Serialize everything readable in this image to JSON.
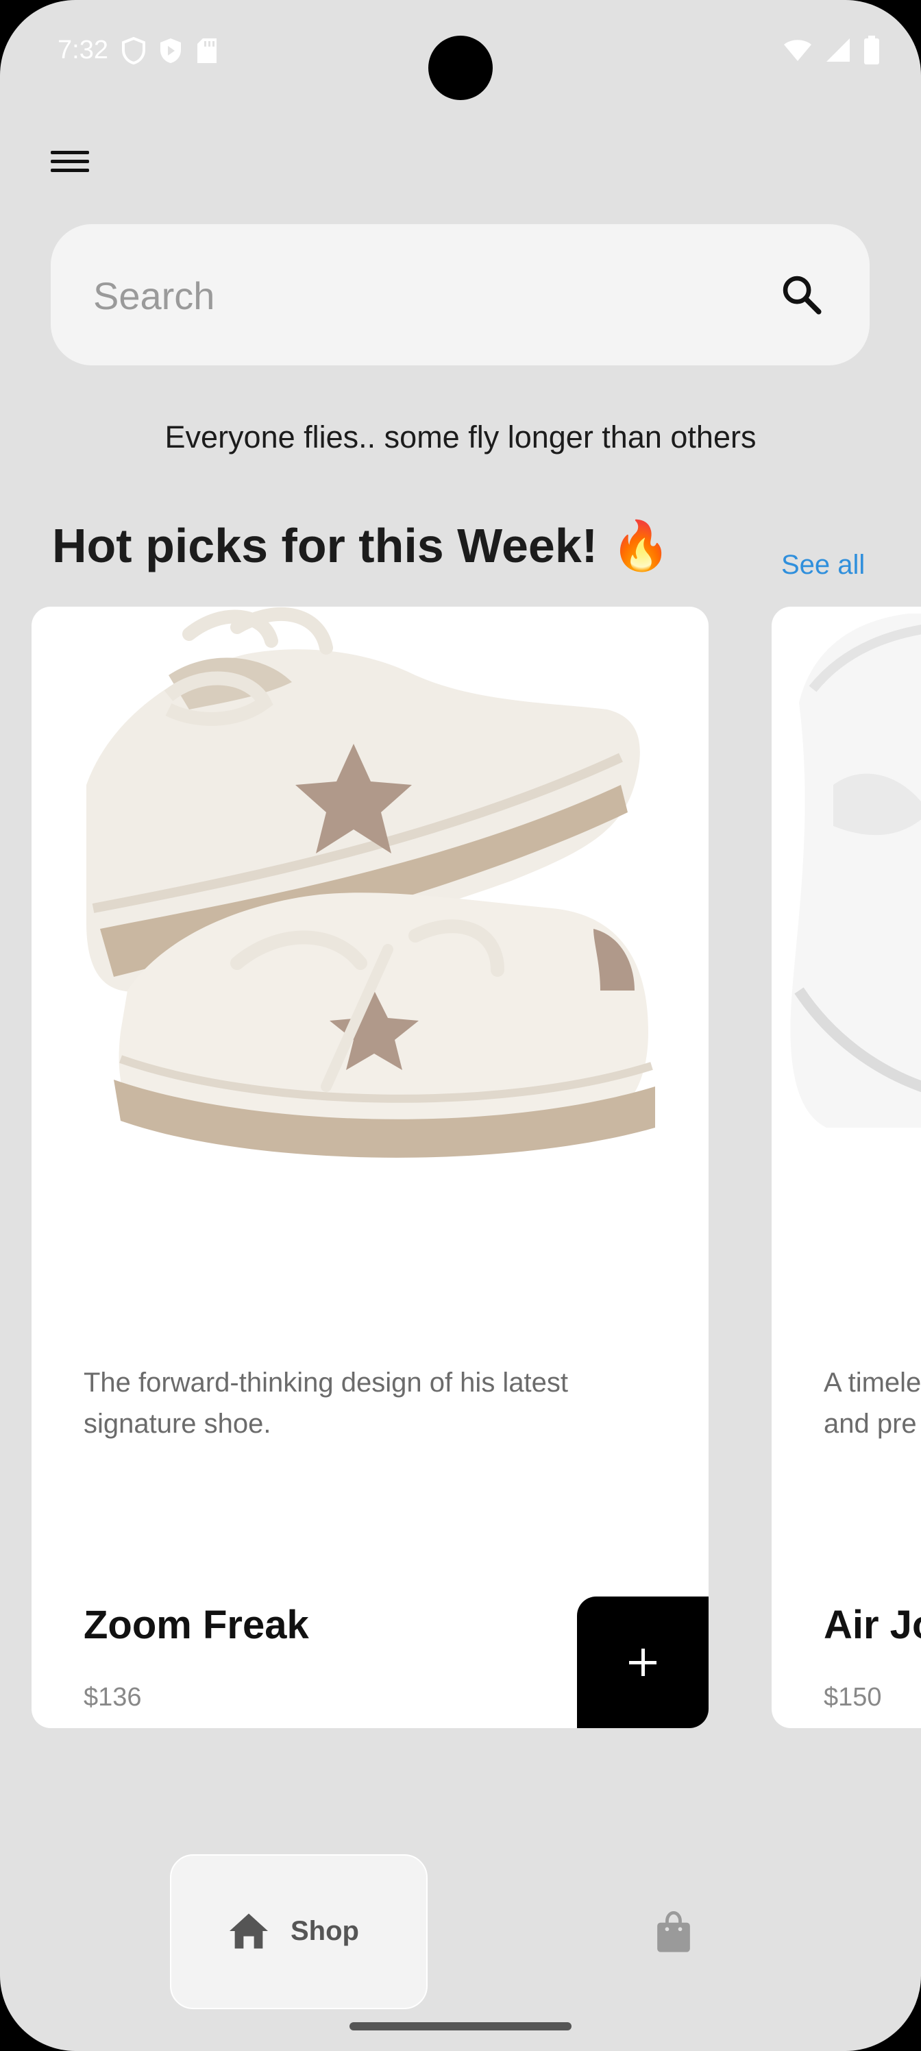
{
  "status_bar": {
    "time": "7:32",
    "left_icons": [
      "shield-icon",
      "play-shield-icon",
      "sd-card-icon"
    ],
    "right_icons": [
      "wifi-icon",
      "signal-icon",
      "battery-icon"
    ]
  },
  "header": {
    "menu_icon": "hamburger-menu-icon"
  },
  "search": {
    "placeholder": "Search",
    "icon": "search-icon"
  },
  "tagline": "Everyone flies.. some fly longer than others",
  "section": {
    "title": "Hot picks for this Week! 🔥",
    "see_all": "See all"
  },
  "products": [
    {
      "description": "The forward-thinking design of his latest signature shoe.",
      "name": "Zoom Freak",
      "price": "$136",
      "add_icon": "plus-icon"
    },
    {
      "description": "A timele... and pre...",
      "description_visible": "A timele\nand pre",
      "name": "Air Jo",
      "price": "$150"
    }
  ],
  "bottom_nav": {
    "shop_label": "Shop",
    "shop_icon": "home-icon",
    "cart_icon": "shopping-bag-icon"
  },
  "colors": {
    "background": "#e1e1e1",
    "card": "#ffffff",
    "accent_link": "#2f8fdc",
    "add_button": "#000000"
  }
}
